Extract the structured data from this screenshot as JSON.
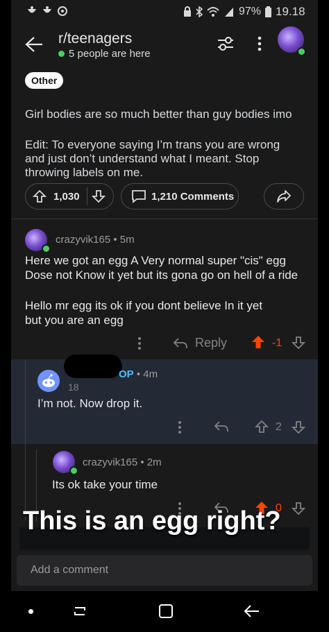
{
  "status_bar": {
    "battery": "97%",
    "time": "19.18"
  },
  "header": {
    "subreddit": "r/teenagers",
    "presence": "5 people are here"
  },
  "post": {
    "flair": "Other",
    "body": "Girl bodies are so much better than guy bodies imo",
    "edit_line1": "Edit: To everyone saying I’m trans you are wrong",
    "edit_line2": "and just don’t understand what I meant. Stop",
    "edit_line3": "throwing labels on me.",
    "votes": "1,030",
    "comments": "1,210 Comments"
  },
  "comments": [
    {
      "author": "crazyvik165",
      "time": "• 5m",
      "line1": "Here we got an egg A Very normal super \"cis\" egg",
      "line2": "Dose not Know it yet but its gona go on hell of a ride",
      "line3": "Hello mr egg its ok if you dont believe In it yet",
      "line4": "but you are an egg",
      "reply_label": "Reply",
      "score": "-1"
    },
    {
      "author_tag": "OP",
      "time": "• 4m",
      "age": "18",
      "text": "I’m not. Now drop it.",
      "score": "2"
    },
    {
      "author": "crazyvik165",
      "time": "• 2m",
      "text": "Its ok take your time",
      "score": "0"
    }
  ],
  "overlay_caption": "This is an egg right?",
  "composer": {
    "placeholder": "Add a comment"
  },
  "colors": {
    "upvote": "#ff4500",
    "online": "#46d160",
    "op": "#4fbcff",
    "background": "#1a1a1b"
  }
}
